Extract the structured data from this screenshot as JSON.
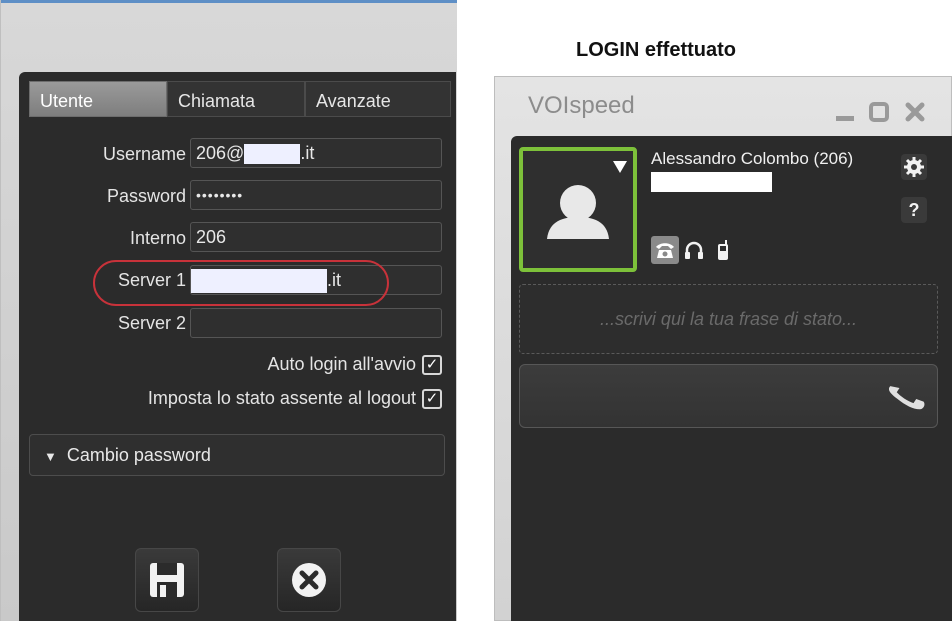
{
  "settings": {
    "tabs": [
      {
        "label": "Utente",
        "active": true
      },
      {
        "label": "Chiamata",
        "active": false
      },
      {
        "label": "Avanzate",
        "active": false
      }
    ],
    "fields": {
      "username": {
        "label": "Username",
        "prefix": "206@",
        "suffix": ".it"
      },
      "password": {
        "label": "Password",
        "value": "••••••••"
      },
      "interno": {
        "label": "Interno",
        "value": "206"
      },
      "server1": {
        "label": "Server 1",
        "suffix": ".it"
      },
      "server2": {
        "label": "Server 2",
        "value": ""
      }
    },
    "options": {
      "auto_login": {
        "label": "Auto login all'avvio",
        "checked": true
      },
      "away_on_logout": {
        "label": "Imposta lo stato assente al logout",
        "checked": true
      }
    },
    "change_password": "Cambio password",
    "icons": [
      "save-icon",
      "close-icon"
    ]
  },
  "caption": "LOGIN effettuato",
  "app": {
    "title": "VOIspeed",
    "window_buttons": [
      "minimize-icon",
      "maximize-icon",
      "close-icon"
    ],
    "user_name": "Alessandro Colombo (206)",
    "status_placeholder": "...scrivi qui la tua frase di stato...",
    "devices": [
      "desk-phone-icon",
      "headset-icon",
      "mobile-phone-icon"
    ],
    "colors": {
      "presence_border": "#7dc13a",
      "highlight": "#c8323a"
    }
  }
}
